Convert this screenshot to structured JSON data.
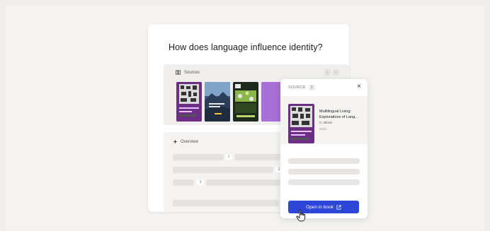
{
  "question": "How does language influence identity?",
  "sources": {
    "label": "Sources",
    "prev_icon": "chevron-left-icon",
    "next_icon": "chevron-right-icon",
    "thumbnails": [
      {
        "name": "book-cover-multilingual",
        "color": "#6d2f86"
      },
      {
        "name": "book-cover-landscape",
        "color": "#2c3d5a"
      },
      {
        "name": "book-cover-green",
        "color": "#1d2a1d"
      },
      {
        "name": "book-cover-purple",
        "color": "#a86fd6"
      }
    ]
  },
  "overview": {
    "label": "Overview",
    "chips": [
      "1",
      "2",
      "3"
    ]
  },
  "popup": {
    "label": "SOURCE",
    "count": "1",
    "book_title": "Multilingual Living: Explorations of Lang...",
    "book_author": "C. Block",
    "book_year": "2022",
    "open_label": "Open in book"
  },
  "colors": {
    "accent": "#2e46d8",
    "cover_purple": "#6d2f86"
  }
}
